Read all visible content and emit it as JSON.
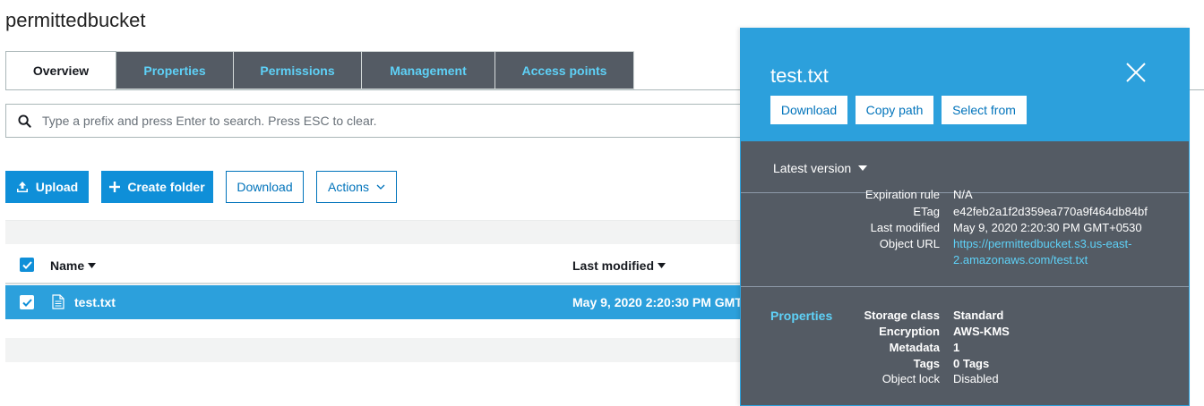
{
  "bucket": {
    "title": "permittedbucket"
  },
  "tabs": [
    {
      "label": "Overview"
    },
    {
      "label": "Properties"
    },
    {
      "label": "Permissions"
    },
    {
      "label": "Management"
    },
    {
      "label": "Access points"
    }
  ],
  "search": {
    "placeholder": "Type a prefix and press Enter to search. Press ESC to clear."
  },
  "toolbar": {
    "upload_label": "Upload",
    "create_folder_label": "Create folder",
    "download_label": "Download",
    "actions_label": "Actions"
  },
  "table": {
    "columns": {
      "name": "Name",
      "last_modified": "Last modified"
    },
    "rows": [
      {
        "name": "test.txt",
        "last_modified": "May 9, 2020 2:20:30 PM GMT"
      }
    ]
  },
  "panel": {
    "title": "test.txt",
    "buttons": {
      "download": "Download",
      "copy_path": "Copy path",
      "select_from": "Select from"
    },
    "version_label": "Latest version",
    "overview": {
      "expiration_rule_label": "Expiration rule",
      "expiration_rule_value": "N/A",
      "etag_label": "ETag",
      "etag_value": "e42feb2a1f2d359ea770a9f464db84bf",
      "last_modified_label": "Last modified",
      "last_modified_value": "May 9, 2020 2:20:30 PM GMT+0530",
      "object_url_label": "Object URL",
      "object_url_line1": "https://permittedbucket.s3.us-east-",
      "object_url_line2": "2.amazonaws.com/test.txt"
    },
    "properties": {
      "heading": "Properties",
      "storage_class_label": "Storage class",
      "storage_class_value": "Standard",
      "encryption_label": "Encryption",
      "encryption_value": "AWS-KMS",
      "metadata_label": "Metadata",
      "metadata_value": "1",
      "tags_label": "Tags",
      "tags_value": "0 Tags",
      "object_lock_label": "Object lock",
      "object_lock_value": "Disabled"
    }
  },
  "colors": {
    "accent_blue": "#2ca0dc",
    "primary_button": "#0f8fd8",
    "tab_dark": "#545b64",
    "tab_text": "#5ed1f7",
    "link_blue": "#0073bb"
  }
}
